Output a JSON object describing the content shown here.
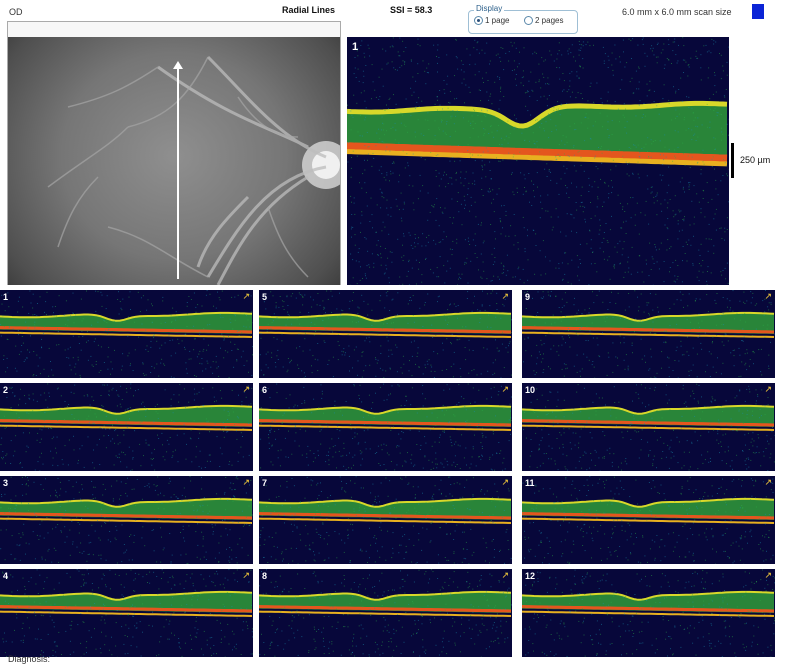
{
  "header": {
    "eye": "OD",
    "scan_type": "Radial Lines",
    "ssi": "SSI = 58.3",
    "display": {
      "legend": "Display",
      "options": [
        "1 page",
        "2 pages"
      ],
      "selected": "1 page"
    },
    "scan_size": "6.0 mm x 6.0 mm scan size",
    "swatch_color": "#0b24d6"
  },
  "main_scan": {
    "number": "1",
    "scale_label": "250 µm"
  },
  "thumbnails": [
    {
      "number": "1"
    },
    {
      "number": "5"
    },
    {
      "number": "9"
    },
    {
      "number": "2"
    },
    {
      "number": "6"
    },
    {
      "number": "10"
    },
    {
      "number": "3"
    },
    {
      "number": "7"
    },
    {
      "number": "11"
    },
    {
      "number": "4"
    },
    {
      "number": "8"
    },
    {
      "number": "12"
    }
  ],
  "footer": {
    "diagnosis_label": "Diagnosis:"
  }
}
